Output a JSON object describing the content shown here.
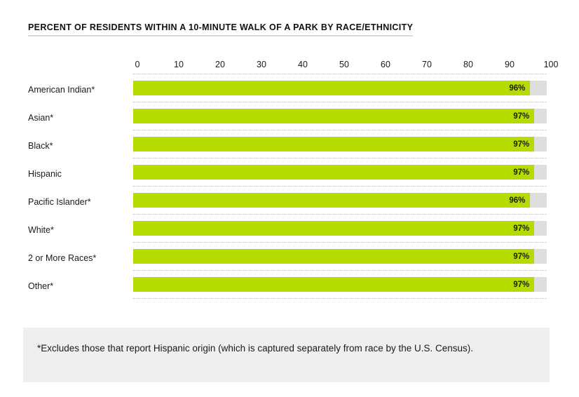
{
  "chart_data": {
    "type": "bar",
    "orientation": "horizontal",
    "title": "PERCENT OF RESIDENTS WITHIN A 10-MINUTE WALK OF A PARK BY RACE/ETHNICITY",
    "xlabel": "",
    "ylabel": "",
    "xlim": [
      0,
      100
    ],
    "grid": false,
    "legend": "none",
    "xticks": [
      "0",
      "10",
      "20",
      "30",
      "40",
      "50",
      "60",
      "70",
      "80",
      "90",
      "100"
    ],
    "xtick_values": [
      0,
      10,
      20,
      30,
      40,
      50,
      60,
      70,
      80,
      90,
      100
    ],
    "categories": [
      "American Indian*",
      "Asian*",
      "Black*",
      "Hispanic",
      "Pacific Islander*",
      "White*",
      "2 or More Races*",
      "Other*"
    ],
    "values": [
      96,
      97,
      97,
      97,
      96,
      97,
      97,
      97
    ],
    "value_labels": [
      "96%",
      "97%",
      "97%",
      "97%",
      "96%",
      "97%",
      "97%",
      "97%"
    ],
    "bar_color": "#b5dc00",
    "track_color": "#dedede",
    "track_max": 100
  },
  "footnote": {
    "text": "*Excludes those that report Hispanic origin (which is captured separately from race by the U.S. Census)."
  },
  "colors": {
    "bar": "#b5dc00",
    "track": "#dedede",
    "footnote_background": "#efefef",
    "text": "#1a1a1a",
    "separator": "#bdbdbd",
    "title_underline": "#d9d9d9"
  }
}
